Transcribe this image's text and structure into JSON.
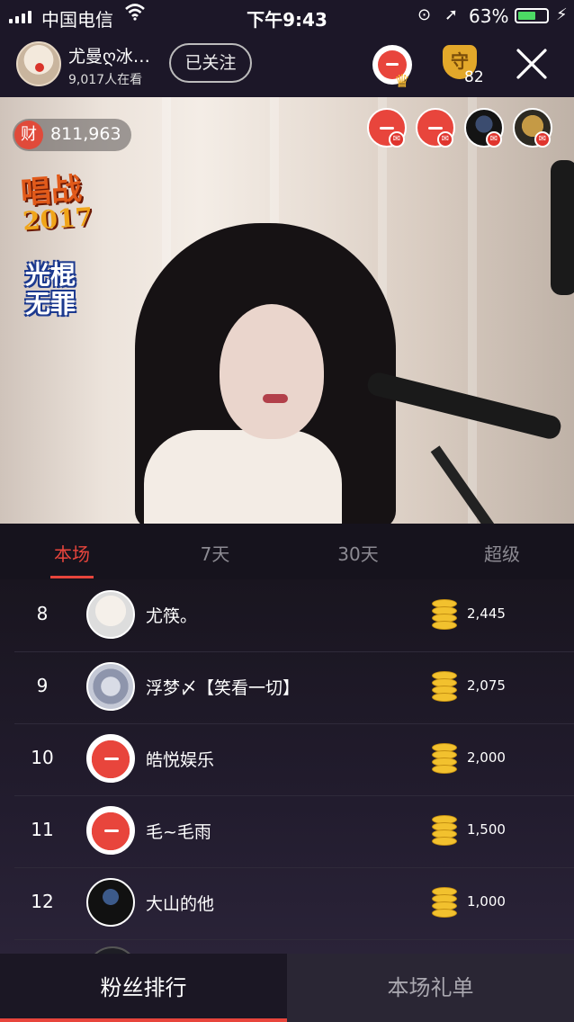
{
  "status_bar": {
    "carrier": "中国电信",
    "time": "下午9:43",
    "battery_percent": "63%",
    "battery_level": 0.63
  },
  "header": {
    "host_name": "尤曼ღ冰…",
    "viewer_count": "9,017人在看",
    "follow_label": "已关注",
    "guard_count": "82"
  },
  "video": {
    "wealth_badge": "财",
    "wealth_value": "811,963",
    "sticker_top": "唱战",
    "sticker_year": "2017",
    "sticker_bottom_1": "光棍",
    "sticker_bottom_2": "无罪"
  },
  "tabs": [
    {
      "label": "本场",
      "active": true
    },
    {
      "label": "7天",
      "active": false
    },
    {
      "label": "30天",
      "active": false
    },
    {
      "label": "超级",
      "active": false
    }
  ],
  "ranking": [
    {
      "rank": "8",
      "name": "尤筷。",
      "amount": "2,445"
    },
    {
      "rank": "9",
      "name": "浮梦〆【笑看一切】",
      "amount": "2,075"
    },
    {
      "rank": "10",
      "name": "皓悦娱乐",
      "amount": "2,000"
    },
    {
      "rank": "11",
      "name": "毛~毛雨",
      "amount": "1,500"
    },
    {
      "rank": "12",
      "name": "大山的他",
      "amount": "1,000"
    }
  ],
  "bottom_tabs": {
    "left": "粉丝排行",
    "right": "本场礼单"
  },
  "colors": {
    "accent": "#e8453c",
    "coin": "#f2c12e",
    "background": "#1a1627"
  }
}
